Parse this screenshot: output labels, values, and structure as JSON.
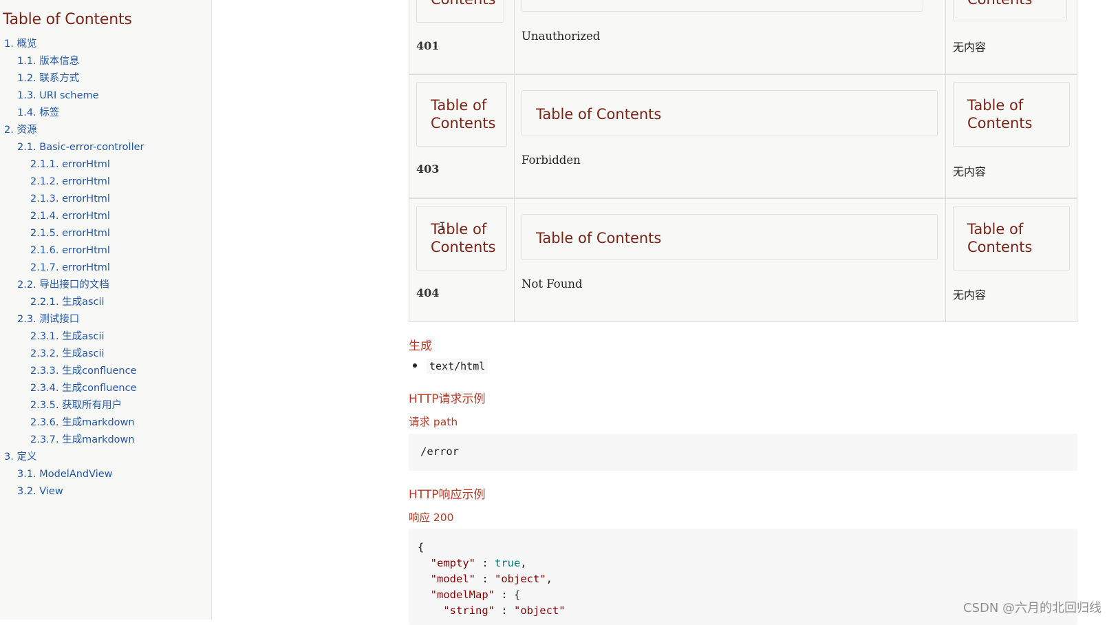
{
  "toc": {
    "title": "Table of Contents",
    "items": [
      {
        "label": "1. 概览",
        "level": 1
      },
      {
        "label": "1.1. 版本信息",
        "level": 2
      },
      {
        "label": "1.2. 联系方式",
        "level": 2
      },
      {
        "label": "1.3. URI scheme",
        "level": 2
      },
      {
        "label": "1.4. 标签",
        "level": 2
      },
      {
        "label": "2. 资源",
        "level": 1
      },
      {
        "label": "2.1. Basic-error-controller",
        "level": 2
      },
      {
        "label": "2.1.1. errorHtml",
        "level": 3
      },
      {
        "label": "2.1.2. errorHtml",
        "level": 3
      },
      {
        "label": "2.1.3. errorHtml",
        "level": 3
      },
      {
        "label": "2.1.4. errorHtml",
        "level": 3
      },
      {
        "label": "2.1.5. errorHtml",
        "level": 3
      },
      {
        "label": "2.1.6. errorHtml",
        "level": 3
      },
      {
        "label": "2.1.7. errorHtml",
        "level": 3
      },
      {
        "label": "2.2. 导出接口的文档",
        "level": 2
      },
      {
        "label": "2.2.1. 生成ascii",
        "level": 3
      },
      {
        "label": "2.3. 测试接口",
        "level": 2
      },
      {
        "label": "2.3.1. 生成ascii",
        "level": 3
      },
      {
        "label": "2.3.2. 生成ascii",
        "level": 3
      },
      {
        "label": "2.3.3. 生成confluence",
        "level": 3
      },
      {
        "label": "2.3.4. 生成confluence",
        "level": 3
      },
      {
        "label": "2.3.5. 获取所有用户",
        "level": 3
      },
      {
        "label": "2.3.6. 生成markdown",
        "level": 3
      },
      {
        "label": "2.3.7. 生成markdown",
        "level": 3
      },
      {
        "label": "3. 定义",
        "level": 1
      },
      {
        "label": "3.1. ModelAndView",
        "level": 2
      },
      {
        "label": "3.2. View",
        "level": 2
      }
    ]
  },
  "responses": {
    "box_label_a": "Table of",
    "box_label_b": "Contents",
    "box_label_full": "Table of Contents",
    "rows": [
      {
        "code": "401",
        "description": "Unauthorized",
        "schema": "无内容"
      },
      {
        "code": "403",
        "description": "Forbidden",
        "schema": "无内容"
      },
      {
        "code": "404",
        "description": "Not Found",
        "schema": "无内容"
      }
    ]
  },
  "produces": {
    "heading": "生成",
    "items": [
      "text/html"
    ]
  },
  "http_request": {
    "heading": "HTTP请求示例",
    "subheading": "请求 path",
    "path": "/error"
  },
  "http_response": {
    "heading": "HTTP响应示例",
    "subheading": "响应 200",
    "json": {
      "open": "{",
      "k_empty": "\"empty\"",
      "v_empty": "true",
      "k_model": "\"model\"",
      "v_model": "\"object\"",
      "k_modelMap": "\"modelMap\"",
      "v_modelMap_open": "{",
      "k_string": "\"string\"",
      "v_string": "\"object\""
    }
  },
  "watermark": "CSDN @六月的北回归线"
}
